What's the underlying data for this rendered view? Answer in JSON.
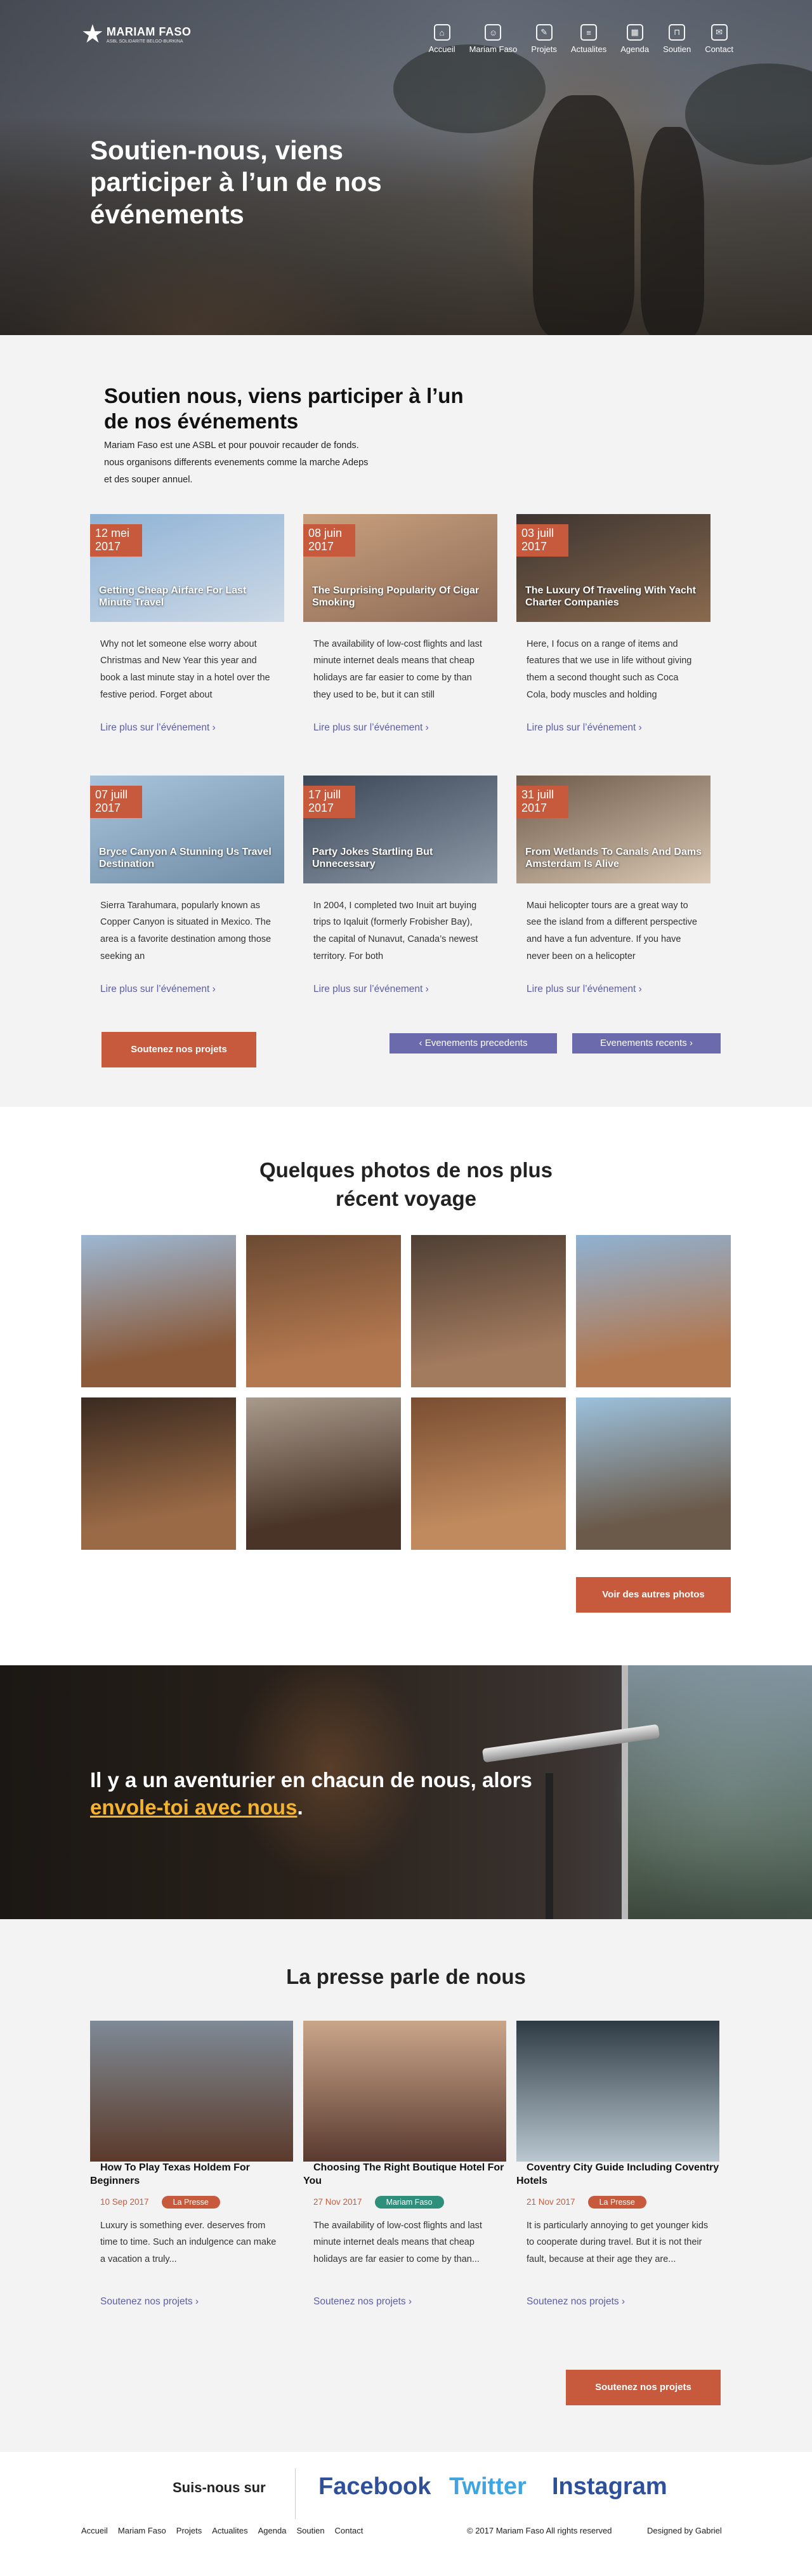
{
  "brand": {
    "logo_star": "★",
    "name": "MARIAM FASO",
    "tagline": "ASBL SOLIDARITE BELGO-BURKINA"
  },
  "nav": [
    {
      "label": "Accueil",
      "icon": "home-icon",
      "glyph": "⌂"
    },
    {
      "label": "Mariam Faso",
      "icon": "smiley-icon",
      "glyph": "☺"
    },
    {
      "label": "Projets",
      "icon": "pencil-icon",
      "glyph": "✎"
    },
    {
      "label": "Actualites",
      "icon": "newspaper-icon",
      "glyph": "≡"
    },
    {
      "label": "Agenda",
      "icon": "calendar-icon",
      "glyph": "▦"
    },
    {
      "label": "Soutien",
      "icon": "shopping-bag-icon",
      "glyph": "⊓"
    },
    {
      "label": "Contact",
      "icon": "envelope-icon",
      "glyph": "✉"
    }
  ],
  "hero": {
    "title": "Soutien-nous, viens participer à l’un de nos événements"
  },
  "events": {
    "title": "Soutien nous, viens participer à l’un de nos événements",
    "description": "Mariam Faso est une ASBL et pour pouvoir recauder de fonds. nous organisons differents evenements comme la marche Adeps et des souper annuel.",
    "more_label": "Lire plus sur l’événement",
    "cards": [
      {
        "date": "12 mei 2017",
        "title": "Getting Cheap Airfare For Last Minute Travel",
        "excerpt": "Why not let someone else worry about Christmas and New Year this year and book a last minute stay in a hotel over the festive period. Forget about",
        "colors": [
          "#8fb3d6",
          "#cdd9e6"
        ]
      },
      {
        "date": "08 juin 2017",
        "title": "The Surprising Popularity Of Cigar Smoking",
        "excerpt": "The availability of low-cost flights and last minute internet deals means that cheap holidays are far easier to come by than they used to be, but it can still",
        "colors": [
          "#c9a17e",
          "#8e6b57"
        ]
      },
      {
        "date": "03 juill 2017",
        "title": "The Luxury Of Traveling With Yacht Charter Companies",
        "excerpt": "Here, I focus on a range of items and features that we use in life without giving them a second thought such as Coca Cola, body muscles and holding",
        "colors": [
          "#3c3430",
          "#8a6a4e"
        ]
      },
      {
        "date": "07 juill 2017",
        "title": "Bryce Canyon A Stunning Us Travel Destination",
        "excerpt": "Sierra Tarahumara, popularly known as Copper Canyon is situated in Mexico. The area is a favorite destination among those seeking an",
        "colors": [
          "#a9c4dd",
          "#6f8ba3"
        ]
      },
      {
        "date": "17 juill 2017",
        "title": "Party Jokes Startling But Unnecessary",
        "excerpt": "In 2004, I completed two Inuit art buying trips to Iqaluit (formerly Frobisher Bay), the capital of Nunavut, Canada’s newest territory. For both",
        "colors": [
          "#3b4656",
          "#8e9aa8"
        ]
      },
      {
        "date": "31 juill 2017",
        "title": "From Wetlands To Canals And Dams Amsterdam Is Alive",
        "excerpt": "Maui helicopter tours are a great way to see the island from a different perspective and have a fun adventure. If you have never been on a helicopter",
        "colors": [
          "#6e5a4a",
          "#d9c8b4"
        ]
      }
    ],
    "cta_label": "Soutenez nos projets",
    "prev_label": "‹   Evenements precedents",
    "next_label": "Evenements recents   ›"
  },
  "photos": {
    "title_line1": "Quelques photos de nos plus",
    "title_line2": "récent voyage",
    "items": [
      {
        "colors": [
          "#9db8d4",
          "#8a5a3a"
        ]
      },
      {
        "colors": [
          "#6b4a33",
          "#b3784f"
        ]
      },
      {
        "colors": [
          "#4e3f34",
          "#a27a5e"
        ]
      },
      {
        "colors": [
          "#8fb2d3",
          "#b27850"
        ]
      },
      {
        "colors": [
          "#3a2a20",
          "#9a6a46"
        ]
      },
      {
        "colors": [
          "#a89a8c",
          "#4a3428"
        ]
      },
      {
        "colors": [
          "#7a4e32",
          "#c08a5e"
        ]
      },
      {
        "colors": [
          "#9cc1dd",
          "#6b5a4a"
        ]
      }
    ],
    "cta_label": "Voir des autres photos"
  },
  "banner": {
    "text_before": "Il y a un aventurier en chacun de nous, alors ",
    "highlight": "envole-toi avec nous",
    "text_after": "."
  },
  "press": {
    "title": "La presse parle de nous",
    "more_label": "Soutenez nos projets",
    "cards": [
      {
        "title": "How To Play Texas Holdem For Beginners",
        "date": "10 Sep 2017",
        "badge": "La Presse",
        "badge_color": "#c75a3c",
        "excerpt": "Luxury is something ever. deserves from time to time. Such an indulgence can make a vacation a truly...",
        "colors": [
          "#7e8a96",
          "#5b3a2a"
        ]
      },
      {
        "title": "Choosing The Right Boutique Hotel For You",
        "date": "27 Nov 2017",
        "badge": "Mariam Faso",
        "badge_color": "#2e8f7a",
        "excerpt": "The availability of low-cost flights and last minute internet deals means that cheap holidays are far easier to come by than...",
        "colors": [
          "#c9a68a",
          "#5a3a30"
        ]
      },
      {
        "title": "Coventry City Guide Including Coventry Hotels",
        "date": "21 Nov 2017",
        "badge": "La Presse",
        "badge_color": "#c75a3c",
        "excerpt": "It is particularly annoying to get younger kids to cooperate during travel. But it is not their fault, because at their age they are...",
        "colors": [
          "#2e3a44",
          "#b9c8d0"
        ]
      }
    ],
    "cta_label": "Soutenez nos projets"
  },
  "follow": {
    "label": "Suis-nous sur",
    "networks": [
      {
        "name": "Facebook",
        "color": "#2e4f9a"
      },
      {
        "name": "Twitter",
        "color": "#3fa4e0"
      },
      {
        "name": "Instagram",
        "color": "#2e4f9a"
      }
    ]
  },
  "footer": {
    "links": [
      "Accueil",
      "Mariam Faso",
      "Projets",
      "Actualites",
      "Agenda",
      "Soutien",
      "Contact"
    ],
    "copyright": "© 2017 Mariam Faso All rights reserved",
    "designer": "Designed by Gabriel"
  }
}
